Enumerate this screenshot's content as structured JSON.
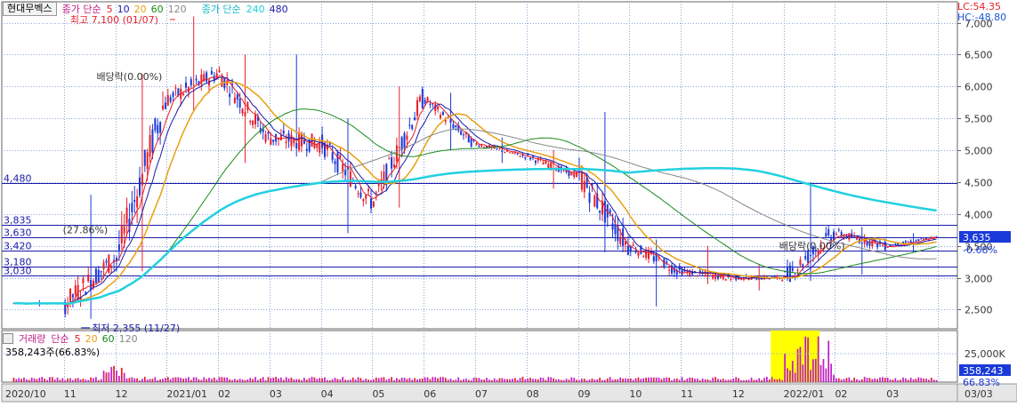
{
  "legend": {
    "stock_name": "현대무벡스",
    "price_prefix": "종가 단순",
    "ma_periods": [
      "5",
      "10",
      "20",
      "60",
      "120"
    ],
    "ma_colors": [
      "#e8202a",
      "#1a1aa8",
      "#e8a010",
      "#1a8a1a",
      "#888888"
    ],
    "long_prefix": "종가 단순",
    "long_periods": [
      "240",
      "480"
    ],
    "long_colors": [
      "#22d0e0",
      "#1a1aa8"
    ]
  },
  "corner": {
    "lc": "LC:54.35",
    "hc": "HC:-48.80"
  },
  "annotations": {
    "high": "최고 7,100 (01/07)",
    "low": "최저 2,355 (11/27)",
    "div1": "배당락(0.00%)",
    "div2": "배당락(0.00%)",
    "pct": "(27.86%)"
  },
  "levels": [
    {
      "label": "4,480",
      "value": 4480
    },
    {
      "label": "3,835",
      "value": 3835
    },
    {
      "label": "3,630",
      "value": 3630
    },
    {
      "label": "3,420",
      "value": 3420
    },
    {
      "label": "3,180",
      "value": 3180
    },
    {
      "label": "3,030",
      "value": 3030
    }
  ],
  "current": {
    "price": "3,635",
    "change": "-0.68%"
  },
  "volume": {
    "legend_prefix": "거래량",
    "legend_type": "단순",
    "periods": [
      "5",
      "20",
      "60",
      "120"
    ],
    "period_colors": [
      "#e8202a",
      "#e8a010",
      "#1a8a1a",
      "#888888"
    ],
    "summary": "358,243주(66.83%)",
    "axis_label": "25,000K",
    "current": "358,243",
    "pct": "66.83%"
  },
  "x_labels": [
    "2020/10",
    "11",
    "12",
    "2021/01",
    "02",
    "03",
    "04",
    "05",
    "06",
    "07",
    "08",
    "09",
    "10",
    "11",
    "12",
    "2022/01",
    "02",
    "03"
  ],
  "x_right_label": "03/03",
  "chart_data": {
    "type": "candlestick",
    "y_ticks": [
      "2,500",
      "3,000",
      "3,500",
      "4,000",
      "4,500",
      "5,000",
      "5,500",
      "6,000",
      "6,500",
      "7,000"
    ],
    "ylim": [
      2200,
      7300
    ],
    "months": [
      {
        "label": "2020/10",
        "open": 2600,
        "high": 2650,
        "low": 2550,
        "close": 2600
      },
      {
        "label": "11",
        "open": 2600,
        "high": 4300,
        "low": 2355,
        "close": 3300
      },
      {
        "label": "12",
        "open": 3300,
        "high": 6200,
        "low": 3100,
        "close": 5800
      },
      {
        "label": "2021/01",
        "open": 5800,
        "high": 7100,
        "low": 5600,
        "close": 6200
      },
      {
        "label": "02",
        "open": 6200,
        "high": 6500,
        "low": 4800,
        "close": 5200
      },
      {
        "label": "03",
        "open": 5200,
        "high": 6500,
        "low": 4900,
        "close": 5100
      },
      {
        "label": "04",
        "open": 5100,
        "high": 5500,
        "low": 3700,
        "close": 4200
      },
      {
        "label": "05",
        "open": 4200,
        "high": 6000,
        "low": 4100,
        "close": 5800
      },
      {
        "label": "06",
        "open": 5800,
        "high": 5900,
        "low": 5000,
        "close": 5100
      },
      {
        "label": "07",
        "open": 5100,
        "high": 5200,
        "low": 4800,
        "close": 4900
      },
      {
        "label": "08",
        "open": 4900,
        "high": 5000,
        "low": 4400,
        "close": 4600
      },
      {
        "label": "09",
        "open": 4600,
        "high": 5600,
        "low": 3400,
        "close": 3500
      },
      {
        "label": "10",
        "open": 3500,
        "high": 3600,
        "low": 2550,
        "close": 3100
      },
      {
        "label": "11",
        "open": 3100,
        "high": 3500,
        "low": 2900,
        "close": 3000
      },
      {
        "label": "12",
        "open": 3000,
        "high": 3200,
        "low": 2800,
        "close": 3000
      },
      {
        "label": "2022/01",
        "open": 3000,
        "high": 4500,
        "low": 2950,
        "close": 3700
      },
      {
        "label": "02",
        "open": 3700,
        "high": 3800,
        "low": 3050,
        "close": 3500
      },
      {
        "label": "03",
        "open": 3500,
        "high": 3700,
        "low": 3400,
        "close": 3635
      }
    ]
  }
}
